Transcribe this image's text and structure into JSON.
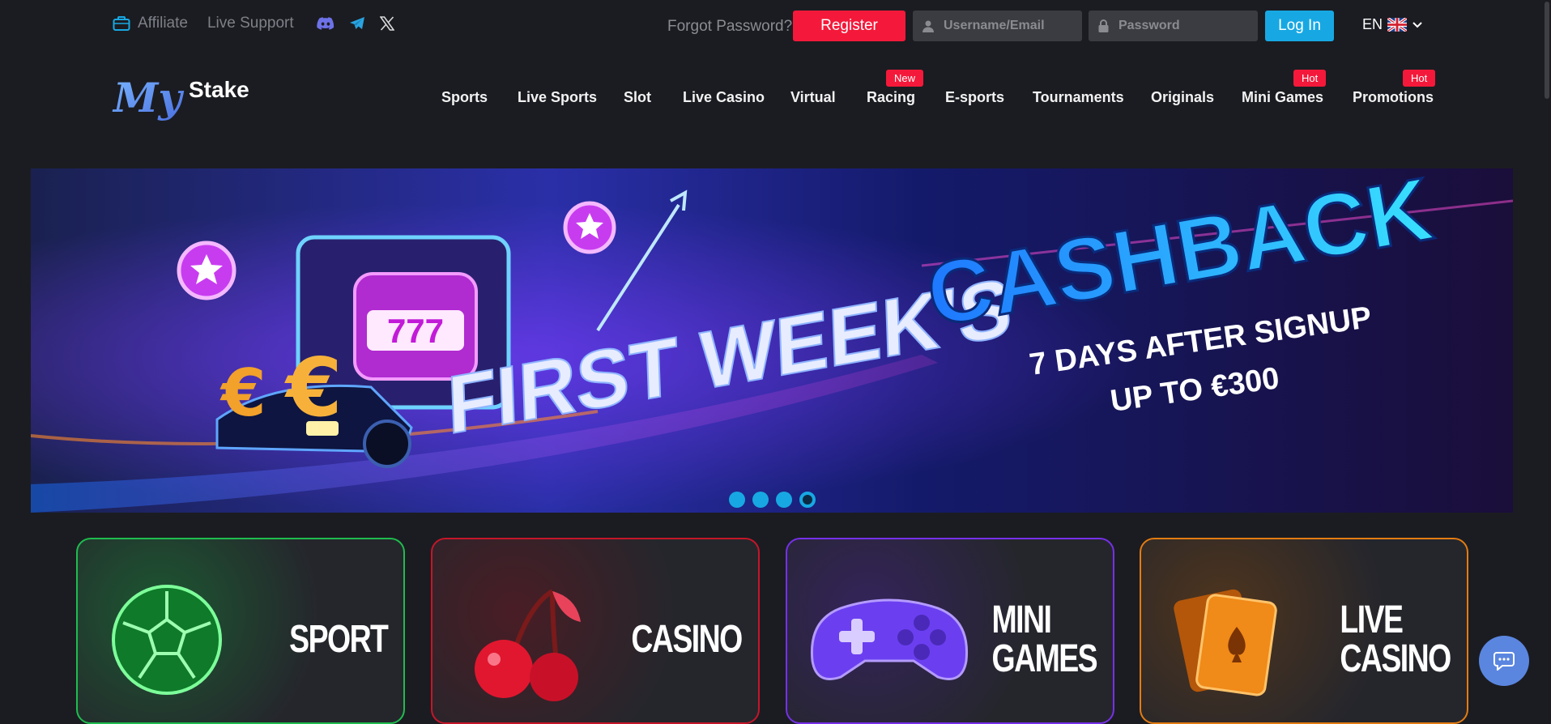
{
  "topbar": {
    "affiliate": "Affiliate",
    "live_support": "Live Support",
    "social": [
      "discord-icon",
      "telegram-icon",
      "x-icon"
    ],
    "forgot_password": "Forgot Password?",
    "register": "Register",
    "username_placeholder": "Username/Email",
    "password_placeholder": "Password",
    "login": "Log In",
    "language": "EN"
  },
  "logo": {
    "text_my": "My",
    "text_stake": "Stake"
  },
  "nav": {
    "items": [
      {
        "label": "Sports"
      },
      {
        "label": "Live Sports"
      },
      {
        "label": "Slot"
      },
      {
        "label": "Live Casino"
      },
      {
        "label": "Virtual"
      },
      {
        "label": "Racing",
        "tag": "New"
      },
      {
        "label": "E-sports"
      },
      {
        "label": "Tournaments"
      },
      {
        "label": "Originals"
      },
      {
        "label": "Mini Games",
        "tag": "Hot"
      },
      {
        "label": "Promotions",
        "tag": "Hot"
      }
    ]
  },
  "banner": {
    "headline_left": "FIRST WEEK'S",
    "headline_right": "CASHBACK",
    "line1": "7 DAYS AFTER SIGNUP",
    "line2": "UP TO €300",
    "slot_digits": "777",
    "slides": 4,
    "active_slide": 4
  },
  "categories": [
    {
      "title_line1": "SPORT",
      "title_line2": ""
    },
    {
      "title_line1": "CASINO",
      "title_line2": ""
    },
    {
      "title_line1": "MINI",
      "title_line2": "GAMES"
    },
    {
      "title_line1": "LIVE",
      "title_line2": "CASINO"
    }
  ],
  "colors": {
    "background": "#1b1c21",
    "register": "#f4193a",
    "login": "#17a8e3",
    "sport": "#1fbc4e",
    "casino": "#c51629",
    "mini_games": "#7630e9",
    "live_casino": "#e37c12"
  }
}
